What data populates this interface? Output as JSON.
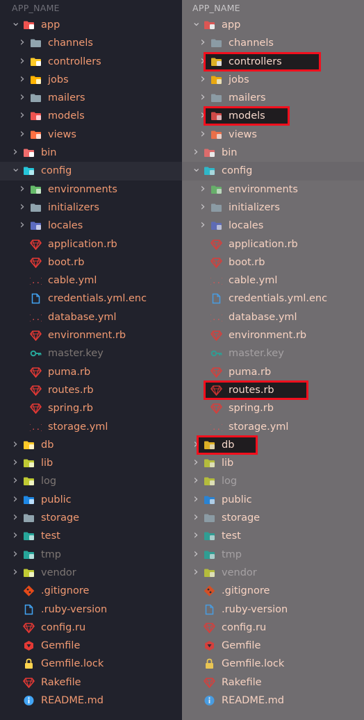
{
  "header": {
    "title": "APP_NAME"
  },
  "tree": [
    {
      "label": "app",
      "depth": 0,
      "kind": "folder",
      "chevron": "open",
      "icon": "rails-folder-icon",
      "color": "#ef5350"
    },
    {
      "label": "channels",
      "depth": 1,
      "kind": "folder",
      "chevron": "closed",
      "icon": "folder-icon",
      "color": "#90a4ae"
    },
    {
      "label": "controllers",
      "depth": 1,
      "kind": "folder",
      "chevron": "closed",
      "icon": "controllers-folder-icon",
      "color": "#ffca28",
      "highlight": true
    },
    {
      "label": "jobs",
      "depth": 1,
      "kind": "folder",
      "chevron": "closed",
      "icon": "jobs-folder-icon",
      "color": "#ffb300"
    },
    {
      "label": "mailers",
      "depth": 1,
      "kind": "folder",
      "chevron": "closed",
      "icon": "folder-icon",
      "color": "#90a4ae"
    },
    {
      "label": "models",
      "depth": 1,
      "kind": "folder",
      "chevron": "closed",
      "icon": "models-folder-icon",
      "color": "#ef5350",
      "highlight": true
    },
    {
      "label": "views",
      "depth": 1,
      "kind": "folder",
      "chevron": "closed",
      "icon": "views-folder-icon",
      "color": "#ff7043"
    },
    {
      "label": "bin",
      "depth": 0,
      "kind": "folder",
      "chevron": "closed",
      "icon": "bin-folder-icon",
      "color": "#ef6c6c"
    },
    {
      "label": "config",
      "depth": 0,
      "kind": "folder",
      "chevron": "open",
      "icon": "config-folder-icon",
      "color": "#26c6da",
      "selected": true
    },
    {
      "label": "environments",
      "depth": 1,
      "kind": "folder",
      "chevron": "closed",
      "icon": "environments-folder-icon",
      "color": "#66bb6a"
    },
    {
      "label": "initializers",
      "depth": 1,
      "kind": "folder",
      "chevron": "closed",
      "icon": "folder-icon",
      "color": "#90a4ae"
    },
    {
      "label": "locales",
      "depth": 1,
      "kind": "folder",
      "chevron": "closed",
      "icon": "locales-folder-icon",
      "color": "#5c6bc0"
    },
    {
      "label": "application.rb",
      "depth": 1,
      "kind": "file",
      "icon": "ruby-icon",
      "color": "#e53935"
    },
    {
      "label": "boot.rb",
      "depth": 1,
      "kind": "file",
      "icon": "ruby-icon",
      "color": "#e53935"
    },
    {
      "label": "cable.yml",
      "depth": 1,
      "kind": "file",
      "icon": "yaml-icon",
      "color": "#ef5350"
    },
    {
      "label": "credentials.yml.enc",
      "depth": 1,
      "kind": "file",
      "icon": "file-icon",
      "color": "#42a5f5"
    },
    {
      "label": "database.yml",
      "depth": 1,
      "kind": "file",
      "icon": "yaml-icon",
      "color": "#ef5350"
    },
    {
      "label": "environment.rb",
      "depth": 1,
      "kind": "file",
      "icon": "ruby-icon",
      "color": "#e53935"
    },
    {
      "label": "master.key",
      "depth": 1,
      "kind": "file",
      "icon": "key-icon",
      "color": "#26a69a",
      "dim": true
    },
    {
      "label": "puma.rb",
      "depth": 1,
      "kind": "file",
      "icon": "ruby-icon",
      "color": "#e53935"
    },
    {
      "label": "routes.rb",
      "depth": 1,
      "kind": "file",
      "icon": "ruby-icon",
      "color": "#e53935",
      "highlight": true
    },
    {
      "label": "spring.rb",
      "depth": 1,
      "kind": "file",
      "icon": "ruby-icon",
      "color": "#e53935"
    },
    {
      "label": "storage.yml",
      "depth": 1,
      "kind": "file",
      "icon": "yaml-icon",
      "color": "#ef5350"
    },
    {
      "label": "db",
      "depth": 0,
      "kind": "folder",
      "chevron": "closed",
      "icon": "db-folder-icon",
      "color": "#ffca28",
      "highlight": true
    },
    {
      "label": "lib",
      "depth": 0,
      "kind": "folder",
      "chevron": "closed",
      "icon": "lib-folder-icon",
      "color": "#c0ca33"
    },
    {
      "label": "log",
      "depth": 0,
      "kind": "folder",
      "chevron": "closed",
      "icon": "log-folder-icon",
      "color": "#c0ca33",
      "dim": true
    },
    {
      "label": "public",
      "depth": 0,
      "kind": "folder",
      "chevron": "closed",
      "icon": "public-folder-icon",
      "color": "#1e88e5"
    },
    {
      "label": "storage",
      "depth": 0,
      "kind": "folder",
      "chevron": "closed",
      "icon": "folder-icon",
      "color": "#90a4ae"
    },
    {
      "label": "test",
      "depth": 0,
      "kind": "folder",
      "chevron": "closed",
      "icon": "test-folder-icon",
      "color": "#26a69a"
    },
    {
      "label": "tmp",
      "depth": 0,
      "kind": "folder",
      "chevron": "closed",
      "icon": "tmp-folder-icon",
      "color": "#26a69a",
      "dim": true
    },
    {
      "label": "vendor",
      "depth": 0,
      "kind": "folder",
      "chevron": "closed",
      "icon": "vendor-folder-icon",
      "color": "#c0ca33",
      "dim": true
    },
    {
      "label": ".gitignore",
      "depth": 0,
      "kind": "file",
      "icon": "git-icon",
      "color": "#e64a19"
    },
    {
      "label": ".ruby-version",
      "depth": 0,
      "kind": "file",
      "icon": "file-icon",
      "color": "#42a5f5"
    },
    {
      "label": "config.ru",
      "depth": 0,
      "kind": "file",
      "icon": "ruby-icon",
      "color": "#e53935"
    },
    {
      "label": "Gemfile",
      "depth": 0,
      "kind": "file",
      "icon": "gemfile-icon",
      "color": "#e53935"
    },
    {
      "label": "Gemfile.lock",
      "depth": 0,
      "kind": "file",
      "icon": "lock-icon",
      "color": "#ffd54f"
    },
    {
      "label": "Rakefile",
      "depth": 0,
      "kind": "file",
      "icon": "ruby-icon",
      "color": "#e53935"
    },
    {
      "label": "README.md",
      "depth": 0,
      "kind": "file",
      "icon": "info-icon",
      "color": "#42a5f5"
    }
  ]
}
